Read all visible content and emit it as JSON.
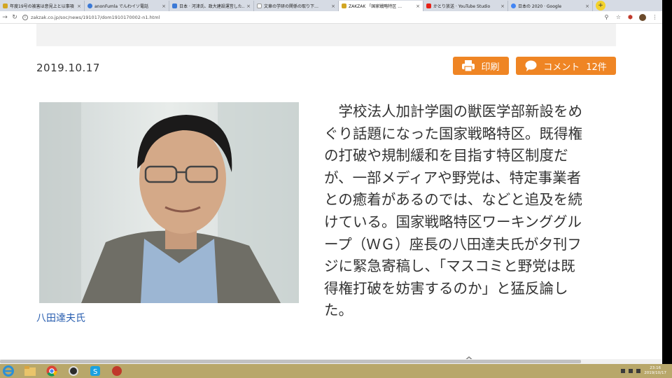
{
  "browser": {
    "tabs": [
      {
        "title": "年度19号の被害は意見上と以事項",
        "icon_color": "#d2a623",
        "active": false
      },
      {
        "title": "anonFumla でんわイソ電話",
        "icon_color": "#3b79d6",
        "active": false
      },
      {
        "title": "日本 · 河津氏、政大建設運営した…",
        "icon_color": "#3b79d6",
        "active": false
      },
      {
        "title": "文章の学研の関係の取り下…",
        "icon_color": "#999999",
        "active": false
      },
      {
        "title": "ZAKZAK 「国家戦略特区 …",
        "icon_color": "#d2a623",
        "active": true
      },
      {
        "title": "かとり放送 · YouTube Studio",
        "icon_color": "#e62117",
        "active": false
      },
      {
        "title": "日本の 2020 · Google",
        "icon_color": "#4285f4",
        "active": false
      }
    ],
    "url": "zakzak.co.jp/soc/news/191017/dom1910170002-n1.html",
    "new_tab_label": "+"
  },
  "article": {
    "date": "2019.10.17",
    "print_label": "印刷",
    "comment_label": "コメント",
    "comment_count": "12件",
    "photo_caption": "八田達夫氏",
    "lines": [
      "　学校法人加計学園の獣医学部新設をめ",
      "ぐり話題になった国家戦略特区。既得権",
      "の打破や規制緩和を目指す特区制度だ",
      "が、一部メディアや野党は、特定事業者",
      "との癒着があるのでは、などと追及を続",
      "けている。国家戦略特区ワーキンググル",
      "ープ（ＷＧ）座長の八田達夫氏が夕刊フ",
      "ジに緊急寄稿し、「マスコミと野党は既",
      "得権打破を妨害するのか」と猛反論し",
      "た。"
    ]
  },
  "taskbar": {
    "time": "23:16",
    "date": "2019/10/17"
  },
  "colors": {
    "accent_orange": "#ef8524",
    "caption_blue": "#2a5fb0",
    "taskbar": "#b8a76a"
  }
}
